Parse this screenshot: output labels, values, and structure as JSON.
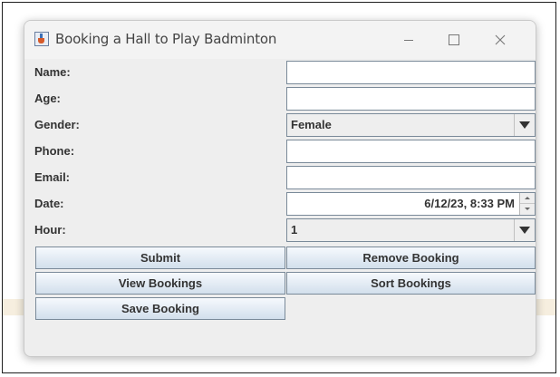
{
  "window": {
    "title": "Booking a Hall to Play Badminton"
  },
  "form": {
    "name": {
      "label": "Name:",
      "value": ""
    },
    "age": {
      "label": "Age:",
      "value": ""
    },
    "gender": {
      "label": "Gender:",
      "value": "Female"
    },
    "phone": {
      "label": "Phone:",
      "value": ""
    },
    "email": {
      "label": "Email:",
      "value": ""
    },
    "date": {
      "label": "Date:",
      "value": "6/12/23, 8:33 PM"
    },
    "hour": {
      "label": "Hour:",
      "value": "1"
    }
  },
  "buttons": {
    "submit": "Submit",
    "remove": "Remove Booking",
    "view": "View Bookings",
    "sort": "Sort Bookings",
    "save": "Save Booking"
  },
  "icons": {
    "app": "java-cup-icon",
    "minimize": "minimize-icon",
    "maximize": "maximize-icon",
    "close": "close-icon"
  },
  "colors": {
    "button_gradient_top": "#f6f9fd",
    "button_gradient_bottom": "#d2dfec",
    "field_border": "#7a8a99",
    "window_bg": "#eeeeee"
  }
}
